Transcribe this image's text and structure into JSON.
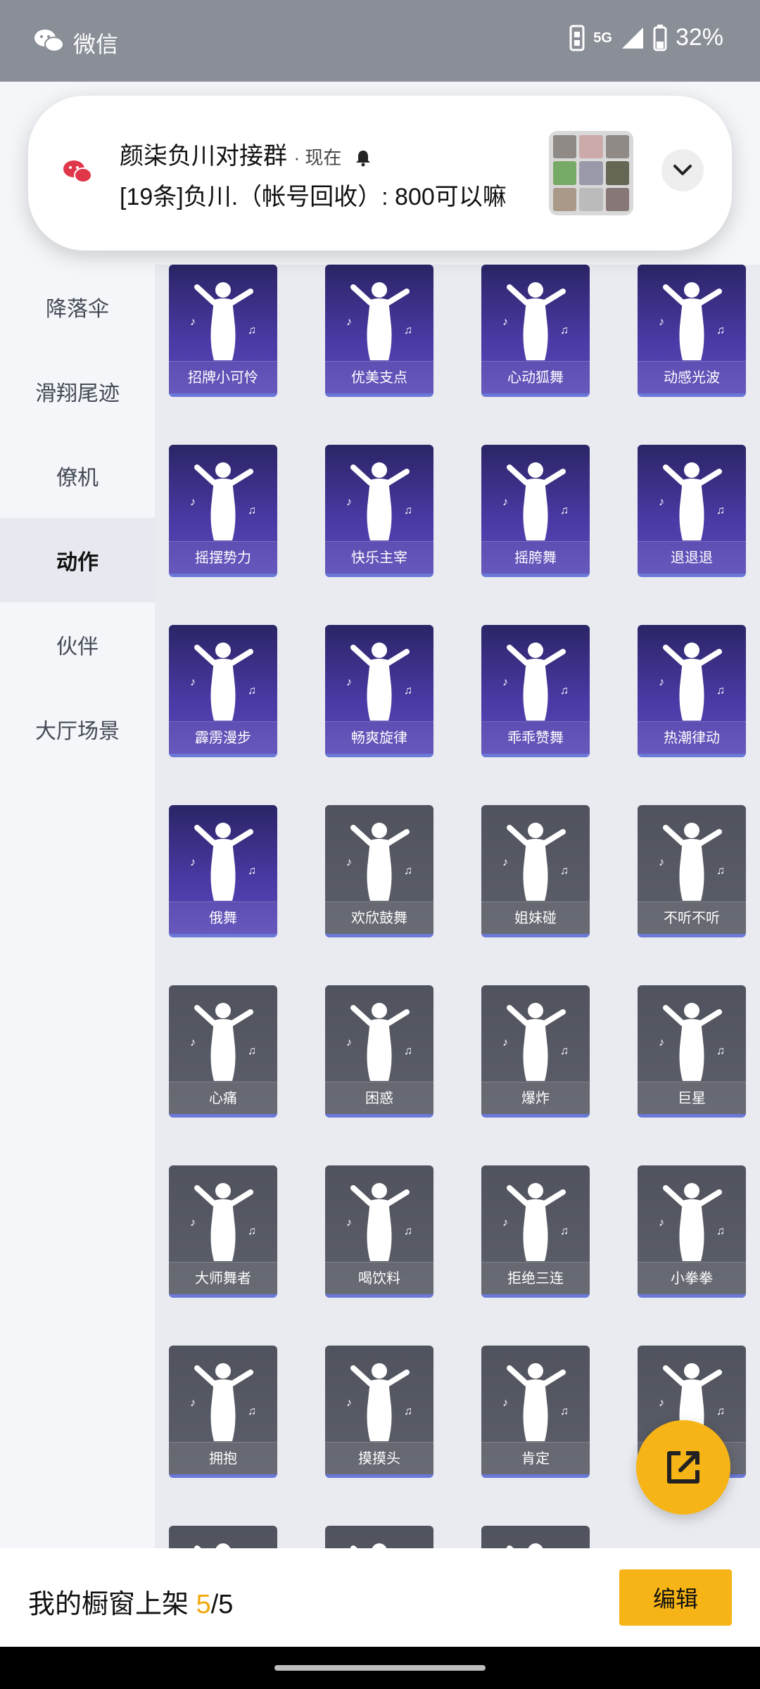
{
  "status_bar": {
    "app_label": "微信",
    "network": "5G",
    "battery": "32%"
  },
  "notification": {
    "title": "颜柒负川对接群",
    "meta": "· 现在",
    "body": "[19条]负川.（帐号回收）: 800可以嘛"
  },
  "sidebar": {
    "items": [
      {
        "label": "降落伞",
        "active": false
      },
      {
        "label": "滑翔尾迹",
        "active": false
      },
      {
        "label": "僚机",
        "active": false
      },
      {
        "label": "动作",
        "active": true
      },
      {
        "label": "伙伴",
        "active": false
      },
      {
        "label": "大厅场景",
        "active": false
      }
    ]
  },
  "grid": {
    "items": [
      {
        "label": "招牌小可怜",
        "style": "purple"
      },
      {
        "label": "优美支点",
        "style": "purple"
      },
      {
        "label": "心动狐舞",
        "style": "purple"
      },
      {
        "label": "动感光波",
        "style": "purple"
      },
      {
        "label": "摇摆势力",
        "style": "purple"
      },
      {
        "label": "快乐主宰",
        "style": "purple"
      },
      {
        "label": "摇胯舞",
        "style": "purple"
      },
      {
        "label": "退退退",
        "style": "purple"
      },
      {
        "label": "霹雳漫步",
        "style": "purple"
      },
      {
        "label": "畅爽旋律",
        "style": "purple"
      },
      {
        "label": "乖乖赞舞",
        "style": "purple"
      },
      {
        "label": "热潮律动",
        "style": "purple"
      },
      {
        "label": "俄舞",
        "style": "purple"
      },
      {
        "label": "欢欣鼓舞",
        "style": "gray"
      },
      {
        "label": "姐妹碰",
        "style": "gray"
      },
      {
        "label": "不听不听",
        "style": "gray"
      },
      {
        "label": "心痛",
        "style": "gray"
      },
      {
        "label": "困惑",
        "style": "gray"
      },
      {
        "label": "爆炸",
        "style": "gray"
      },
      {
        "label": "巨星",
        "style": "gray"
      },
      {
        "label": "大师舞者",
        "style": "gray"
      },
      {
        "label": "喝饮料",
        "style": "gray"
      },
      {
        "label": "拒绝三连",
        "style": "gray"
      },
      {
        "label": "小拳拳",
        "style": "gray"
      },
      {
        "label": "拥抱",
        "style": "gray"
      },
      {
        "label": "摸摸头",
        "style": "gray"
      },
      {
        "label": "肯定",
        "style": "gray"
      },
      {
        "label": "",
        "style": "gray"
      },
      {
        "label": "",
        "style": "gray"
      },
      {
        "label": "",
        "style": "gray"
      },
      {
        "label": "",
        "style": "gray"
      }
    ]
  },
  "bottom_bar": {
    "label": "我的橱窗上架 ",
    "count_current": "5",
    "count_sep": "/",
    "count_total": "5",
    "edit_label": "编辑"
  },
  "colors": {
    "accent": "#f7b416",
    "card_purple": "#4a3aa6",
    "card_gray": "#5c5f69",
    "card_underline": "#6a78d8"
  }
}
